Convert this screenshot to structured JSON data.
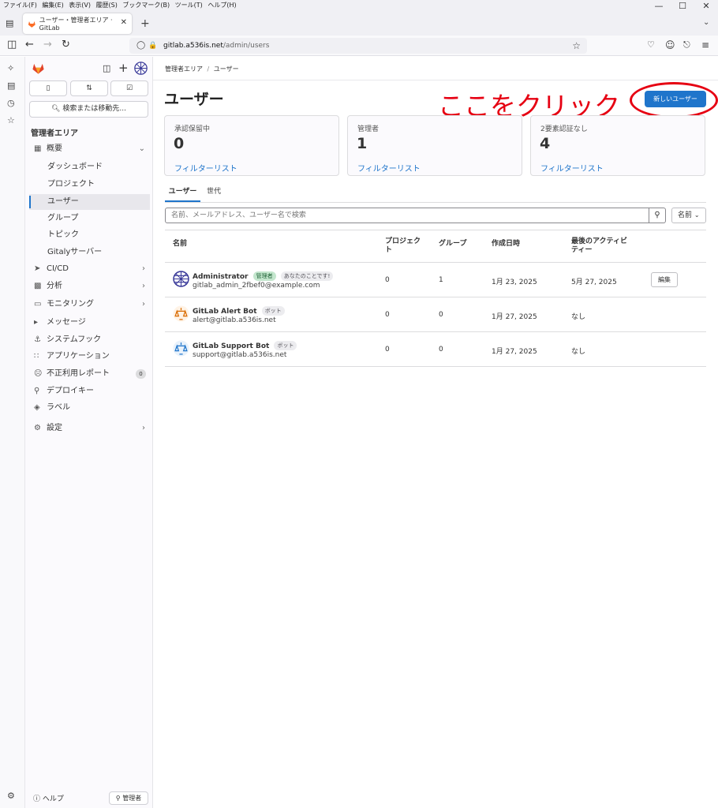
{
  "menubar": [
    "ファイル(F)",
    "編集(E)",
    "表示(V)",
    "履歴(S)",
    "ブックマーク(B)",
    "ツール(T)",
    "ヘルプ(H)"
  ],
  "tab": {
    "title": "ユーザー・管理者エリア · GitLab"
  },
  "url": {
    "host": "gitlab.a536is.net",
    "path": "/admin/users"
  },
  "sidebar": {
    "search_label": "検索または移動先...",
    "area_title": "管理者エリア",
    "overview": "概要",
    "sub_items": [
      "ダッシュボード",
      "プロジェクト",
      "ユーザー",
      "グループ",
      "トピック",
      "Gitalyサーバー"
    ],
    "items": [
      "CI/CD",
      "分析",
      "モニタリング",
      "メッセージ",
      "システムフック",
      "アプリケーション",
      "不正利用レポート",
      "デプロイキー",
      "ラベル"
    ],
    "abuse_count": "0",
    "settings": "設定",
    "help": "ヘルプ",
    "admin": "管理者"
  },
  "breadcrumb": {
    "root": "管理者エリア",
    "sep": "/",
    "current": "ユーザー"
  },
  "page": {
    "title": "ユーザー",
    "annotation": "ここをクリック",
    "new_user_button": "新しいユーザー"
  },
  "stats": [
    {
      "label": "承認保留中",
      "value": "0",
      "link": "フィルターリスト"
    },
    {
      "label": "管理者",
      "value": "1",
      "link": "フィルターリスト"
    },
    {
      "label": "2要素認証なし",
      "value": "4",
      "link": "フィルターリスト"
    }
  ],
  "tabs": [
    "ユーザー",
    "世代"
  ],
  "search": {
    "placeholder": "名前、メールアドレス、ユーザー名で検索",
    "sort": "名前"
  },
  "table": {
    "headers": [
      "名前",
      "プロジェクト",
      "グループ",
      "作成日時",
      "最後のアクティビティー"
    ],
    "rows": [
      {
        "name": "Administrator",
        "badges": [
          "管理者",
          "あなたのことです!"
        ],
        "email": "gitlab_admin_2fbef0@example.com",
        "projects": "0",
        "groups": "1",
        "created": "1月 23, 2025",
        "last": "5月 27, 2025",
        "action": "編集"
      },
      {
        "name": "GitLab Alert Bot",
        "badges": [
          "ボット"
        ],
        "email": "alert@gitlab.a536is.net",
        "projects": "0",
        "groups": "0",
        "created": "1月 27, 2025",
        "last": "なし"
      },
      {
        "name": "GitLab Support Bot",
        "badges": [
          "ボット"
        ],
        "email": "support@gitlab.a536is.net",
        "projects": "0",
        "groups": "0",
        "created": "1月 27, 2025",
        "last": "なし"
      }
    ]
  },
  "colors": {
    "accent": "#1f75cb",
    "annotation": "#e60012",
    "gitlab_orange": "#fc6d26"
  }
}
